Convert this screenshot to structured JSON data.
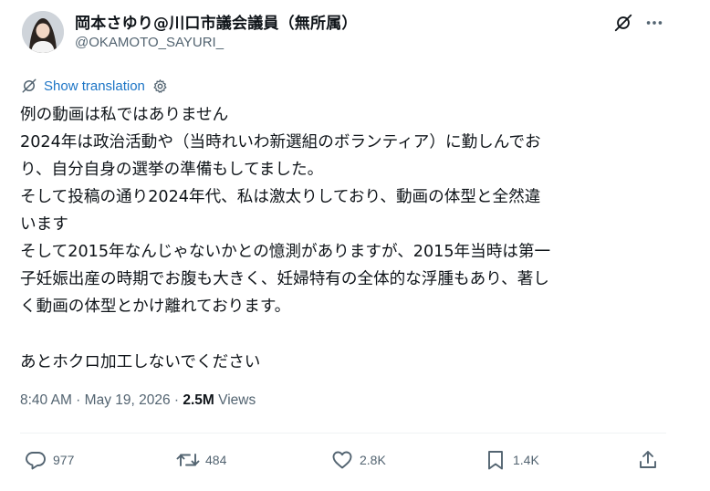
{
  "author": {
    "display_name": "岡本さゆり@川口市議会議員（無所属）",
    "handle": "@OKAMOTO_SAYURI_",
    "avatar_icon": "user-avatar-photo"
  },
  "header_icons": {
    "grok": "grok-icon",
    "more": "more-horizontal-icon"
  },
  "translation": {
    "label": "Show translation",
    "icon": "translate-icon",
    "settings_icon": "gear-icon"
  },
  "tweet": {
    "lines": [
      "例の動画は私ではありません",
      "2024年は政治活動や（当時れいわ新選組のボランティア）に勤しんでお",
      "り、自分自身の選挙の準備もしてました。",
      "そして投稿の通り2024年代、私は激太りしており、動画の体型と全然違",
      "います",
      "そして2015年なんじゃないかとの憶測がありますが、2015年当時は第一",
      "子妊娠出産の時期でお腹も大きく、妊婦特有の全体的な浮腫もあり、著し",
      "く動画の体型とかけ離れております。",
      "",
      "あとホクロ加工しないでください"
    ]
  },
  "meta": {
    "time": "8:40 AM",
    "separator": " · ",
    "date": "May 19, 2026",
    "views_count": "2.5M",
    "views_label": " Views"
  },
  "actions": {
    "reply_count": "977",
    "retweet_count": "484",
    "like_count": "2.8K",
    "bookmark_count": "1.4K"
  },
  "colors": {
    "text": "#0f1419",
    "secondary": "#536471",
    "link": "#1d75c6",
    "divider": "#eff3f4"
  }
}
